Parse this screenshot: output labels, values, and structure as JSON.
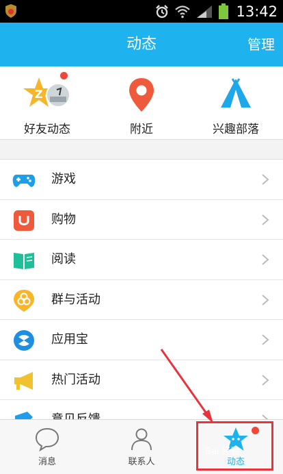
{
  "status_bar": {
    "time": "13:42"
  },
  "header": {
    "title": "动态",
    "manage": "管理"
  },
  "quick_entries": [
    {
      "label": "好友动态",
      "icon": "friend-feed-star-icon",
      "has_badge": true
    },
    {
      "label": "附近",
      "icon": "location-pin-icon",
      "has_badge": false
    },
    {
      "label": "兴趣部落",
      "icon": "tribe-tent-icon",
      "has_badge": false
    }
  ],
  "list_items": [
    {
      "label": "游戏",
      "icon": "gamepad-icon",
      "color": "#1e9ee8"
    },
    {
      "label": "购物",
      "icon": "shopping-bag-icon",
      "color": "#ef5a3c"
    },
    {
      "label": "阅读",
      "icon": "book-icon",
      "color": "#1fbf9a"
    },
    {
      "label": "群与活动",
      "icon": "group-activity-icon",
      "color": "#f7b52a"
    },
    {
      "label": "应用宝",
      "icon": "app-store-icon",
      "color": "#1e8fe0"
    },
    {
      "label": "热门活动",
      "icon": "megaphone-icon",
      "color": "#f2c12e"
    },
    {
      "label": "意见反馈",
      "icon": "feedback-icon",
      "color": "#1e9ee8"
    }
  ],
  "tab_bar": [
    {
      "label": "消息",
      "icon": "message-bubble-icon",
      "active": false
    },
    {
      "label": "联系人",
      "icon": "contacts-person-icon",
      "active": false
    },
    {
      "label": "动态",
      "icon": "feed-star-icon",
      "active": true
    }
  ],
  "watermark": "Bai 经验",
  "colors": {
    "accent": "#1eb3ee",
    "badge": "#f1473b",
    "annotation": "#e8333b"
  }
}
